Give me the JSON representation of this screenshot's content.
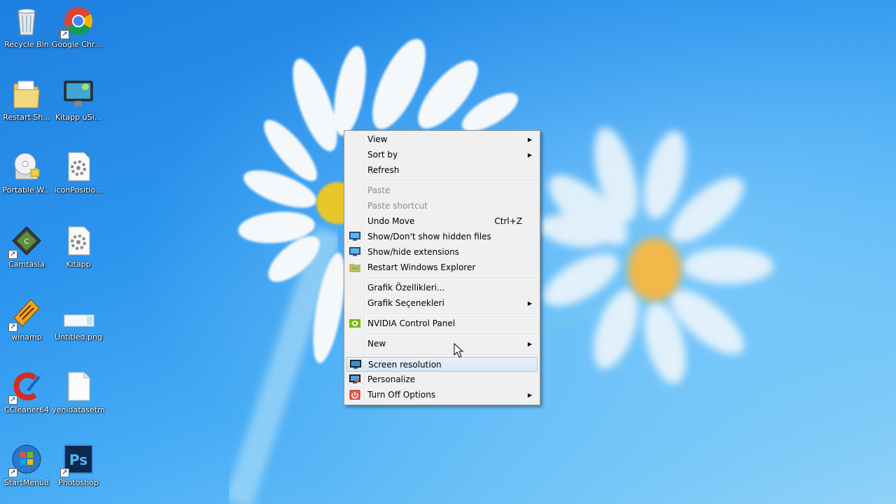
{
  "desktop_icons": [
    {
      "label": "Recycle Bin",
      "icon": "recycle-bin-icon"
    },
    {
      "label": "Google Chrome",
      "icon": "chrome-icon"
    },
    {
      "label": "Restart Sh...",
      "icon": "folder-icon"
    },
    {
      "label": "Kitapp uSi...",
      "icon": "monitor-icon"
    },
    {
      "label": "Portable W...",
      "icon": "cd-installer-icon"
    },
    {
      "label": "iconPositio...",
      "icon": "settings-file-icon"
    },
    {
      "label": "Camtasia",
      "icon": "camtasia-icon"
    },
    {
      "label": "Kitapp",
      "icon": "settings-file-icon"
    },
    {
      "label": "winamp",
      "icon": "winamp-icon"
    },
    {
      "label": "Untitled.png",
      "icon": "image-file-icon"
    },
    {
      "label": "CCleaner64",
      "icon": "ccleaner-icon"
    },
    {
      "label": "yenidatasetm",
      "icon": "blank-file-icon"
    },
    {
      "label": "StartMenu8",
      "icon": "windows-start-icon"
    },
    {
      "label": "Photoshop",
      "icon": "photoshop-icon"
    }
  ],
  "context_menu": {
    "items": [
      {
        "label": "View",
        "submenu": true
      },
      {
        "label": "Sort by",
        "submenu": true
      },
      {
        "label": "Refresh"
      },
      {
        "label": "Paste",
        "disabled": true
      },
      {
        "label": "Paste shortcut",
        "disabled": true
      },
      {
        "label": "Undo Move",
        "shortcut": "Ctrl+Z"
      },
      {
        "label": "Show/Don't show hidden files",
        "icon": "monitor-icon"
      },
      {
        "label": "Show/hide extensions",
        "icon": "monitor-icon"
      },
      {
        "label": "Restart Windows Explorer",
        "icon": "explorer-icon"
      },
      {
        "label": "Grafik Özellikleri..."
      },
      {
        "label": "Grafik Seçenekleri",
        "submenu": true
      },
      {
        "label": "NVIDIA Control Panel",
        "icon": "nvidia-icon"
      },
      {
        "label": "New",
        "submenu": true
      },
      {
        "label": "Screen resolution",
        "icon": "screen-resolution-icon",
        "highlighted": true
      },
      {
        "label": "Personalize",
        "icon": "personalize-icon"
      },
      {
        "label": "Turn Off Options",
        "icon": "power-icon",
        "submenu": true
      }
    ]
  },
  "colors": {
    "accent_highlight": "#d9e6f6",
    "desktop_blue": "#2b95ee"
  }
}
